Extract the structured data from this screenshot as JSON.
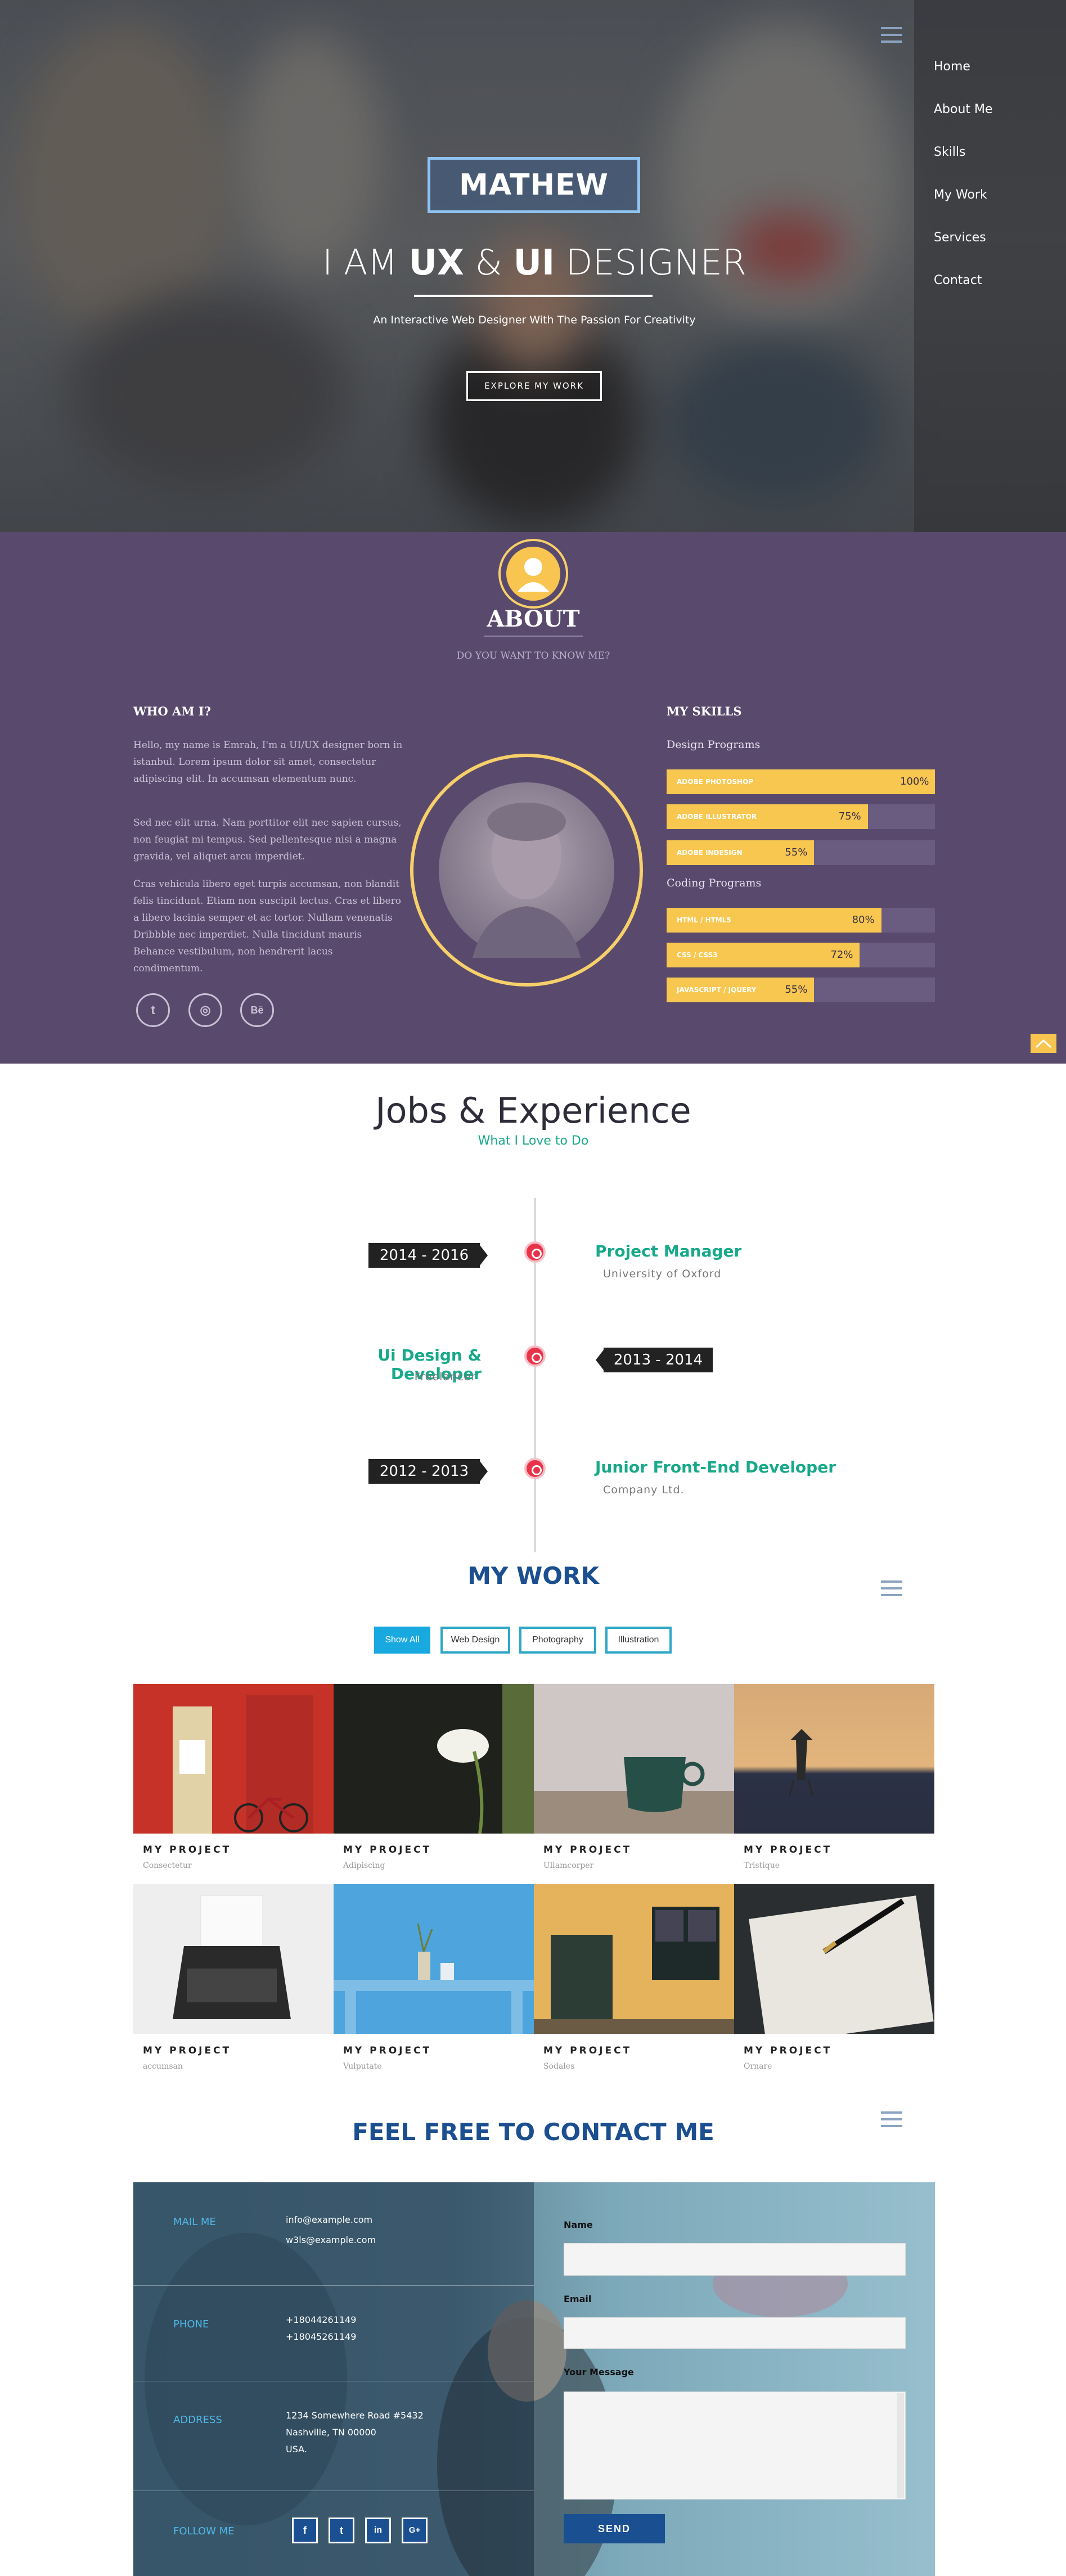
{
  "nav": {
    "items": [
      "Home",
      "About Me",
      "Skills",
      "My Work",
      "Services",
      "Contact"
    ]
  },
  "hero": {
    "name": "MATHEW",
    "title_prefix": "I AM",
    "title_ux": "UX",
    "title_amp": "&",
    "title_ui": "UI",
    "title_suffix": "DESIGNER",
    "subtitle": "An Interactive Web Designer With The Passion For Creativity",
    "button": "EXPLORE MY WORK"
  },
  "about": {
    "title": "ABOUT",
    "subtitle": "DO YOU WANT TO KNOW ME?",
    "who_heading": "WHO AM I?",
    "paragraphs": [
      "Hello, my name is Emrah, I'm a UI/UX designer born in istanbul. Lorem ipsum dolor sit amet, consectetur adipiscing elit. In accumsan elementum nunc.",
      "Sed nec elit urna. Nam porttitor elit nec sapien cursus, non feugiat mi tempus. Sed pellentesque nisi a magna gravida, vel aliquet arcu imperdiet.",
      "Cras vehicula libero eget turpis accumsan, non blandit felis tincidunt. Etiam non suscipit lectus. Cras et libero a libero lacinia semper et ac tortor. Nullam venenatis Dribbble nec imperdiet. Nulla tincidunt mauris Behance vestibulum, non hendrerit lacus condimentum."
    ],
    "social": [
      "twitter-icon",
      "dribbble-icon",
      "behance-icon"
    ],
    "social_glyphs": [
      "t",
      "◎",
      "Bē"
    ],
    "skills_heading": "MY SKILLS",
    "design_group": "Design Programs",
    "coding_group": "Coding Programs",
    "design_skills": [
      {
        "name": "ADOBE PHOTOSHOP",
        "percent": 100,
        "label": "100%"
      },
      {
        "name": "ADOBE ILLUSTRATOR",
        "percent": 75,
        "label": "75%"
      },
      {
        "name": "ADOBE INDESIGN",
        "percent": 55,
        "label": "55%"
      }
    ],
    "coding_skills": [
      {
        "name": "HTML / HTML5",
        "percent": 80,
        "label": "80%"
      },
      {
        "name": "CSS / CSS3",
        "percent": 72,
        "label": "72%"
      },
      {
        "name": "JAVASCRIPT / JQUERY",
        "percent": 55,
        "label": "55%"
      }
    ],
    "accent": "#f7c550",
    "background": "#594a6d"
  },
  "jobs": {
    "title": "Jobs & Experience",
    "subtitle": "What I Love to Do",
    "entries": [
      {
        "date": "2014 - 2016",
        "role": "Project Manager",
        "org": "University of Oxford"
      },
      {
        "date": "2013 - 2014",
        "role": "Ui Design & Developer",
        "org": "Freelancer"
      },
      {
        "date": "2012 - 2013",
        "role": "Junior Front-End Developer",
        "org": "Company Ltd."
      }
    ]
  },
  "work": {
    "title": "MY WORK",
    "filters": [
      "Show All",
      "Web Design",
      "Photography",
      "Illustration"
    ],
    "active_filter": "Show All",
    "projects": [
      {
        "title": "MY PROJECT",
        "category": "Consectetur"
      },
      {
        "title": "MY PROJECT",
        "category": "Adipiscing"
      },
      {
        "title": "MY PROJECT",
        "category": "Ullamcorper"
      },
      {
        "title": "MY PROJECT",
        "category": "Tristique"
      },
      {
        "title": "MY PROJECT",
        "category": "accumsan"
      },
      {
        "title": "MY PROJECT",
        "category": "Vulputate"
      },
      {
        "title": "MY PROJECT",
        "category": "Sodales"
      },
      {
        "title": "MY PROJECT",
        "category": "Ornare"
      }
    ]
  },
  "contact": {
    "title": "FEEL FREE TO CONTACT ME",
    "mail_label": "MAIL ME",
    "mail_values": [
      "info@example.com",
      "w3ls@example.com"
    ],
    "phone_label": "PHONE",
    "phone_values": [
      "+18044261149",
      "+18045261149"
    ],
    "address_label": "ADDRESS",
    "address_values": [
      "1234 Somewhere Road #5432",
      "Nashville, TN 00000",
      "USA."
    ],
    "follow_label": "FOLLOW ME",
    "follow_icons": [
      "f",
      "t",
      "in",
      "G+"
    ],
    "form": {
      "name_label": "Name",
      "email_label": "Email",
      "message_label": "Your Message",
      "send": "SEND"
    }
  }
}
